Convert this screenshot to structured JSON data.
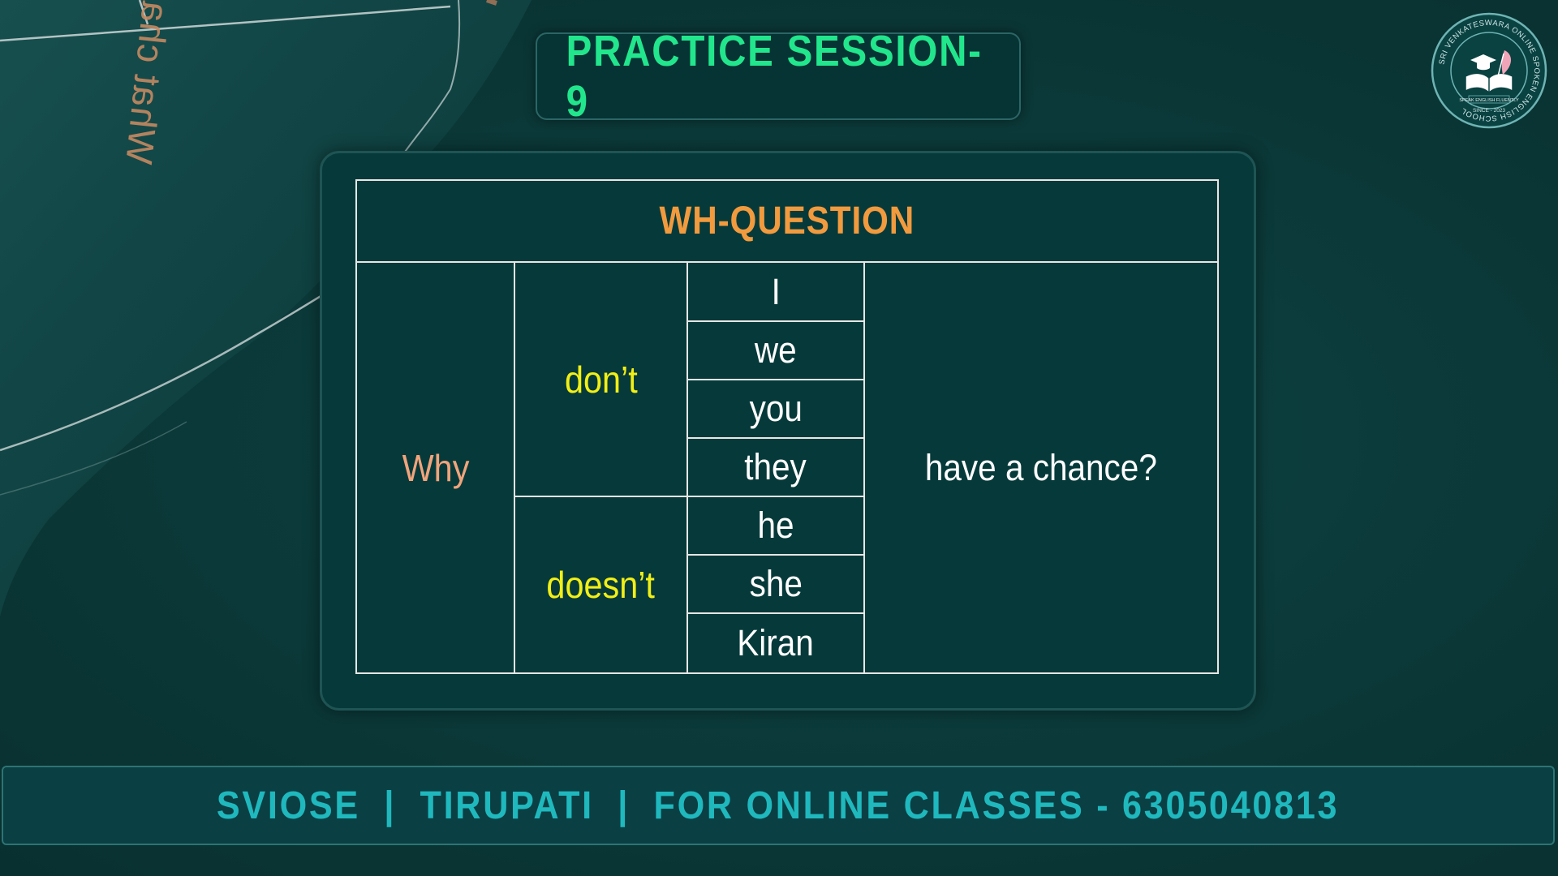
{
  "title": "PRACTICE SESSION-9",
  "decor_text": "What chance",
  "logo": {
    "ring_text": "SRI VENKATESWARA ONLINE SPOKEN ENGLISH SCHOOL",
    "tagline": "SPEAK ENGLISH FLUENTLY",
    "since": "SINCE - 2023",
    "icon": "open-book-graduation-cap-quill-icon"
  },
  "table": {
    "header": "WH-QUESTION",
    "wh_word": "Why",
    "aux_1": "don’t",
    "aux_2": "doesn’t",
    "subjects": [
      "I",
      "we",
      "you",
      "they",
      "he",
      "she",
      "Kiran"
    ],
    "rest": "have a chance?"
  },
  "footer": "SVIOSE  |  TIRUPATI  |  FOR ONLINE CLASSES - 6305040813",
  "colors": {
    "background": "#0c3b3b",
    "title_green": "#22e68c",
    "header_orange": "#f19a3e",
    "wh_peach": "#f1a47c",
    "aux_yellow": "#f2ef16",
    "footer_teal": "#1fb8bd"
  }
}
